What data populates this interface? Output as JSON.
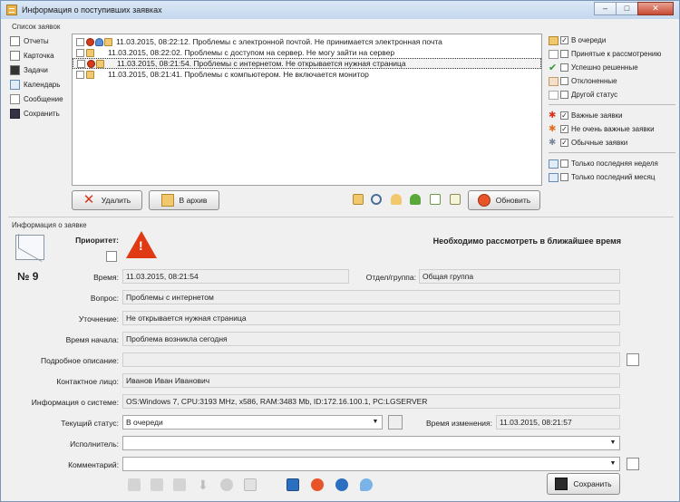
{
  "window": {
    "title": "Информация о поступивших заявках",
    "controls": [
      "–",
      "□",
      "✕"
    ]
  },
  "list_group": {
    "label": "Список заявок"
  },
  "sidebar": {
    "items": [
      {
        "label": "Отчеты",
        "icon": "reports-icon"
      },
      {
        "label": "Карточка",
        "icon": "card-icon"
      },
      {
        "label": "Задачи",
        "icon": "tasks-icon"
      },
      {
        "label": "Календарь",
        "icon": "calendar-icon"
      },
      {
        "label": "Сообщение",
        "icon": "message-icon"
      },
      {
        "label": "Сохранить",
        "icon": "save-icon"
      }
    ]
  },
  "requests": [
    {
      "text": "11.03.2015, 08:22:12. Проблемы с электронной почтой. Не принимается электронная почта",
      "icons": [
        "warning",
        "person"
      ],
      "selected": false
    },
    {
      "text": "11.03.2015, 08:22:02. Проблемы с доступом на сервер. Не могу зайти на сервер",
      "icons": [
        "blank",
        "blank"
      ],
      "selected": false
    },
    {
      "text": "11.03.2015, 08:21:54. Проблемы с интернетом. Не открывается нужная страница",
      "icons": [
        "warning",
        "blank"
      ],
      "selected": true
    },
    {
      "text": "11.03.2015, 08:21:41. Проблемы с компьютером. Не включается монитор",
      "icons": [
        "blank",
        "blank"
      ],
      "selected": false
    }
  ],
  "filters": {
    "status": [
      {
        "label": "В очереди",
        "checked": true
      },
      {
        "label": "Принятые к рассмотрению",
        "checked": false
      },
      {
        "label": "Успешно решенные",
        "checked": false
      },
      {
        "label": "Отклоненные",
        "checked": false
      },
      {
        "label": "Другой статус",
        "checked": false
      }
    ],
    "importance": [
      {
        "label": "Важные заявки",
        "checked": true
      },
      {
        "label": "Не очень важные заявки",
        "checked": true
      },
      {
        "label": "Обычные заявки",
        "checked": true
      }
    ],
    "period": [
      {
        "label": "Только последняя неделя",
        "checked": false
      },
      {
        "label": "Только последний месяц",
        "checked": false
      }
    ]
  },
  "actions": {
    "delete_label": "Удалить",
    "archive_label": "В архив",
    "refresh_label": "Обновить"
  },
  "details": {
    "group_label": "Информация о заявке",
    "priority_label": "Приоритет:",
    "priority_message": "Необходимо рассмотреть в ближайшее время",
    "number": "№ 9",
    "time_label": "Время:",
    "time_value": "11.03.2015, 08:21:54",
    "dept_label": "Отдел/группа:",
    "dept_value": "Общая группа",
    "question_label": "Вопрос:",
    "question_value": "Проблемы с интернетом",
    "clarification_label": "Уточнение:",
    "clarification_value": "Не открывается нужная страница",
    "start_label": "Время начала:",
    "start_value": "Проблема возникла сегодня",
    "description_label": "Подробное описание:",
    "description_value": "",
    "contact_label": "Контактное лицо:",
    "contact_value": "Иванов Иван Иванович",
    "sysinfo_label": "Информация о системе:",
    "sysinfo_value": "OS:Windows 7, CPU:3193 MHz, x586, RAM:3483 Mb, ID:172.16.100.1, PC:LGSERVER",
    "status_label": "Текущий статус:",
    "status_value": "В очереди",
    "changed_label": "Время изменения:",
    "changed_value": "11.03.2015, 08:21:57",
    "executor_label": "Исполнитель:",
    "executor_value": "",
    "comment_label": "Комментарий:",
    "comment_value": "",
    "save_label": "Сохранить"
  },
  "colors": {
    "accent_blue": "#2c6fc0",
    "warning_red": "#d8361a",
    "envelope": "#f2c86e"
  }
}
